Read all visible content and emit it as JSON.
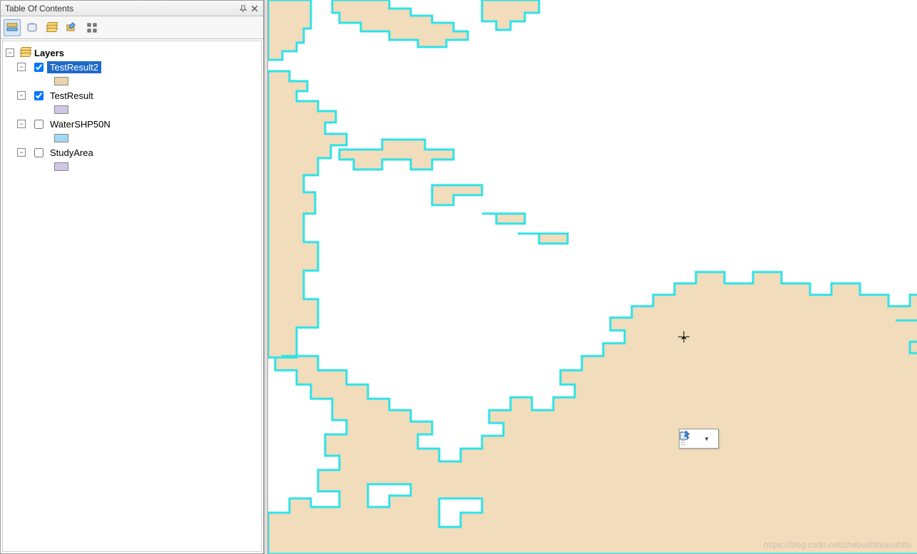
{
  "toc": {
    "title": "Table Of Contents",
    "root_label": "Layers",
    "layers": [
      {
        "name": "TestResult2",
        "checked": true,
        "selected": true,
        "swatch": "#ebd3ac"
      },
      {
        "name": "TestResult",
        "checked": true,
        "selected": false,
        "swatch": "#cfc5e6"
      },
      {
        "name": "WaterSHP50N",
        "checked": false,
        "selected": false,
        "swatch": "#a3d9f2"
      },
      {
        "name": "StudyArea",
        "checked": false,
        "selected": false,
        "swatch": "#cfc5e6"
      }
    ]
  },
  "map": {
    "fill_color": "#f1dcbb",
    "outline_color": "#2fe2e8",
    "background": "#ffffff"
  },
  "floating_toolbar": {
    "tool": "select-by-rectangle"
  },
  "watermark": "https://blog.csdn.net/zhebushibiaoshifu"
}
